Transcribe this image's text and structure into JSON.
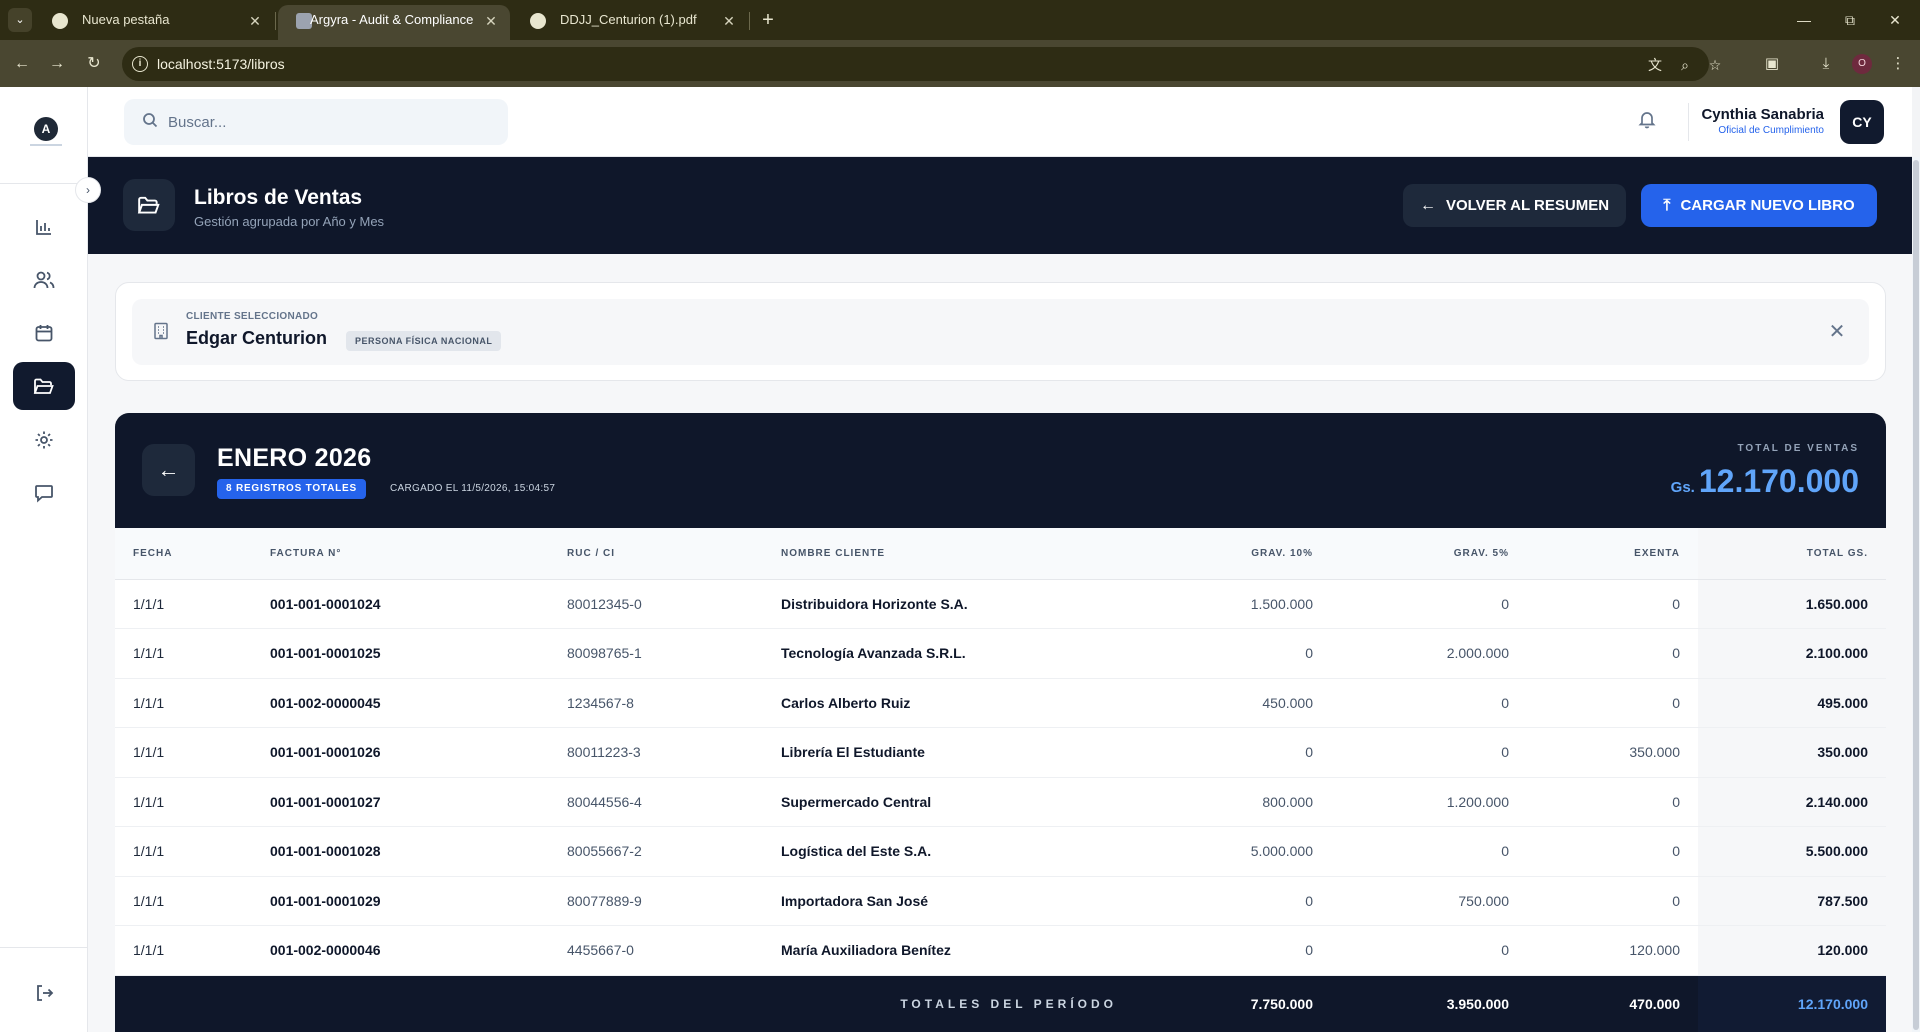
{
  "browser": {
    "tabs": [
      {
        "title": "Nueva pestaña"
      },
      {
        "title": "Argyra - Audit & Compliance"
      },
      {
        "title": "DDJJ_Centurion (1).pdf"
      }
    ],
    "url": "localhost:5173/libros",
    "profile_initial": "O"
  },
  "topbar": {
    "search_placeholder": "Buscar...",
    "user_name": "Cynthia Sanabria",
    "user_role": "Oficial de Cumplimiento",
    "avatar_initials": "CY"
  },
  "page_header": {
    "title": "Libros de Ventas",
    "subtitle": "Gestión agrupada por Año y Mes",
    "back_button": "VOLVER AL RESUMEN",
    "upload_button": "CARGAR NUEVO LIBRO"
  },
  "client": {
    "label": "CLIENTE SELECCIONADO",
    "name": "Edgar Centurion",
    "badge": "PERSONA FÍSICA NACIONAL"
  },
  "ledger": {
    "title": "ENERO 2026",
    "records_badge": "8 REGISTROS TOTALES",
    "loaded_at": "CARGADO EL 11/5/2026, 15:04:57",
    "total_label": "TOTAL DE VENTAS",
    "total_currency": "Gs.",
    "total_amount": "12.170.000",
    "columns": [
      "FECHA",
      "FACTURA N°",
      "RUC / CI",
      "NOMBRE CLIENTE",
      "GRAV. 10%",
      "GRAV. 5%",
      "EXENTA",
      "TOTAL GS."
    ],
    "rows": [
      {
        "fecha": "1/1/1",
        "factura": "001-001-0001024",
        "ruc": "80012345-0",
        "cliente": "Distribuidora Horizonte S.A.",
        "grav10": "1.500.000",
        "grav5": "0",
        "exenta": "0",
        "total": "1.650.000"
      },
      {
        "fecha": "1/1/1",
        "factura": "001-001-0001025",
        "ruc": "80098765-1",
        "cliente": "Tecnología Avanzada S.R.L.",
        "grav10": "0",
        "grav5": "2.000.000",
        "exenta": "0",
        "total": "2.100.000"
      },
      {
        "fecha": "1/1/1",
        "factura": "001-002-0000045",
        "ruc": "1234567-8",
        "cliente": "Carlos Alberto Ruiz",
        "grav10": "450.000",
        "grav5": "0",
        "exenta": "0",
        "total": "495.000"
      },
      {
        "fecha": "1/1/1",
        "factura": "001-001-0001026",
        "ruc": "80011223-3",
        "cliente": "Librería El Estudiante",
        "grav10": "0",
        "grav5": "0",
        "exenta": "350.000",
        "total": "350.000"
      },
      {
        "fecha": "1/1/1",
        "factura": "001-001-0001027",
        "ruc": "80044556-4",
        "cliente": "Supermercado Central",
        "grav10": "800.000",
        "grav5": "1.200.000",
        "exenta": "0",
        "total": "2.140.000"
      },
      {
        "fecha": "1/1/1",
        "factura": "001-001-0001028",
        "ruc": "80055667-2",
        "cliente": "Logística del Este S.A.",
        "grav10": "5.000.000",
        "grav5": "0",
        "exenta": "0",
        "total": "5.500.000"
      },
      {
        "fecha": "1/1/1",
        "factura": "001-001-0001029",
        "ruc": "80077889-9",
        "cliente": "Importadora San José",
        "grav10": "0",
        "grav5": "750.000",
        "exenta": "0",
        "total": "787.500"
      },
      {
        "fecha": "1/1/1",
        "factura": "001-002-0000046",
        "ruc": "4455667-0",
        "cliente": "María Auxiliadora Benítez",
        "grav10": "0",
        "grav5": "0",
        "exenta": "120.000",
        "total": "120.000"
      }
    ],
    "footer": {
      "label": "TOTALES DEL PERÍODO",
      "grav10": "7.750.000",
      "grav5": "3.950.000",
      "exenta": "470.000",
      "total": "12.170.000"
    }
  },
  "colors": {
    "navy": "#0f172a",
    "accent_blue": "#2563eb",
    "total_blue": "#60a5fa"
  }
}
